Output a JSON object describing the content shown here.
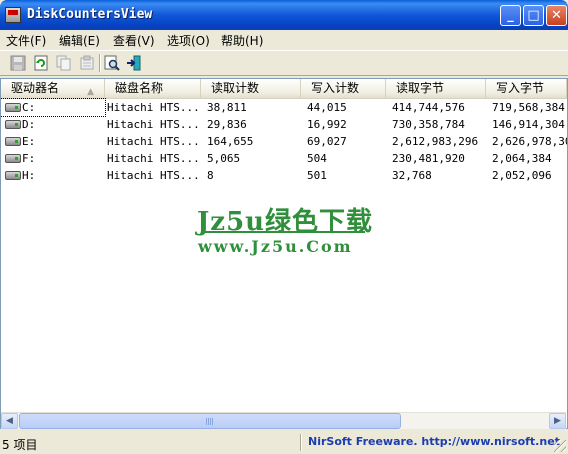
{
  "window": {
    "title": "DiskCountersView",
    "buttons": {
      "minimize": "_",
      "maximize": "□",
      "close": "✕"
    }
  },
  "menu": [
    "文件(F)",
    "编辑(E)",
    "查看(V)",
    "选项(O)",
    "帮助(H)"
  ],
  "toolbar": {
    "icons": [
      "save-icon",
      "refresh-icon",
      "copy-icon",
      "properties-icon",
      "find-icon",
      "exit-icon"
    ]
  },
  "table": {
    "columns": [
      "驱动器名",
      "磁盘名称",
      "读取计数",
      "写入计数",
      "读取字节",
      "写入字节"
    ],
    "sort_indicator": "▲",
    "rows": [
      [
        "C:",
        "Hitachi HTS...",
        "38,811",
        "44,015",
        "414,744,576",
        "719,568,384"
      ],
      [
        "D:",
        "Hitachi HTS...",
        "29,836",
        "16,992",
        "730,358,784",
        "146,914,304"
      ],
      [
        "E:",
        "Hitachi HTS...",
        "164,655",
        "69,027",
        "2,612,983,296",
        "2,626,978,304"
      ],
      [
        "F:",
        "Hitachi HTS...",
        "5,065",
        "504",
        "230,481,920",
        "2,064,384"
      ],
      [
        "H:",
        "Hitachi HTS...",
        "8",
        "501",
        "32,768",
        "2,052,096"
      ]
    ]
  },
  "watermark": {
    "line1": "Jz5u绿色下载",
    "line2": "www.Jz5u.Com"
  },
  "status": {
    "count": "5 项目",
    "link": "NirSoft Freeware.  http://www.nirsoft.net"
  }
}
